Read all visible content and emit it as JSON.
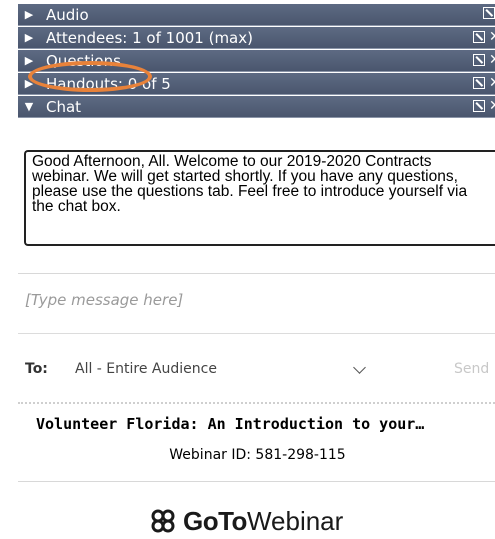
{
  "sections": [
    {
      "label": "Audio",
      "expanded": false
    },
    {
      "label": "Attendees: 1 of 1001 (max)",
      "expanded": false
    },
    {
      "label": "Questions",
      "expanded": false
    },
    {
      "label": "Handouts: 0 of 5",
      "expanded": false
    },
    {
      "label": "Chat",
      "expanded": true
    }
  ],
  "chat": {
    "message": "Good Afternoon, All. Welcome to our 2019-2020 Contracts webinar. We will get started shortly. If you have any questions, please use the questions tab. Feel free to introduce yourself via the chat box.",
    "input_placeholder": "[Type message here]",
    "to_label": "To:",
    "audience": "All - Entire Audience",
    "send_label": "Send"
  },
  "webinar": {
    "title": "Volunteer Florida: An Introduction to your…",
    "id_text": "Webinar ID: 581-298-115"
  },
  "logo": {
    "bold": "GoTo",
    "regular": "Webinar"
  },
  "colors": {
    "bar": "#4f5b73",
    "highlight": "#e8823a"
  }
}
